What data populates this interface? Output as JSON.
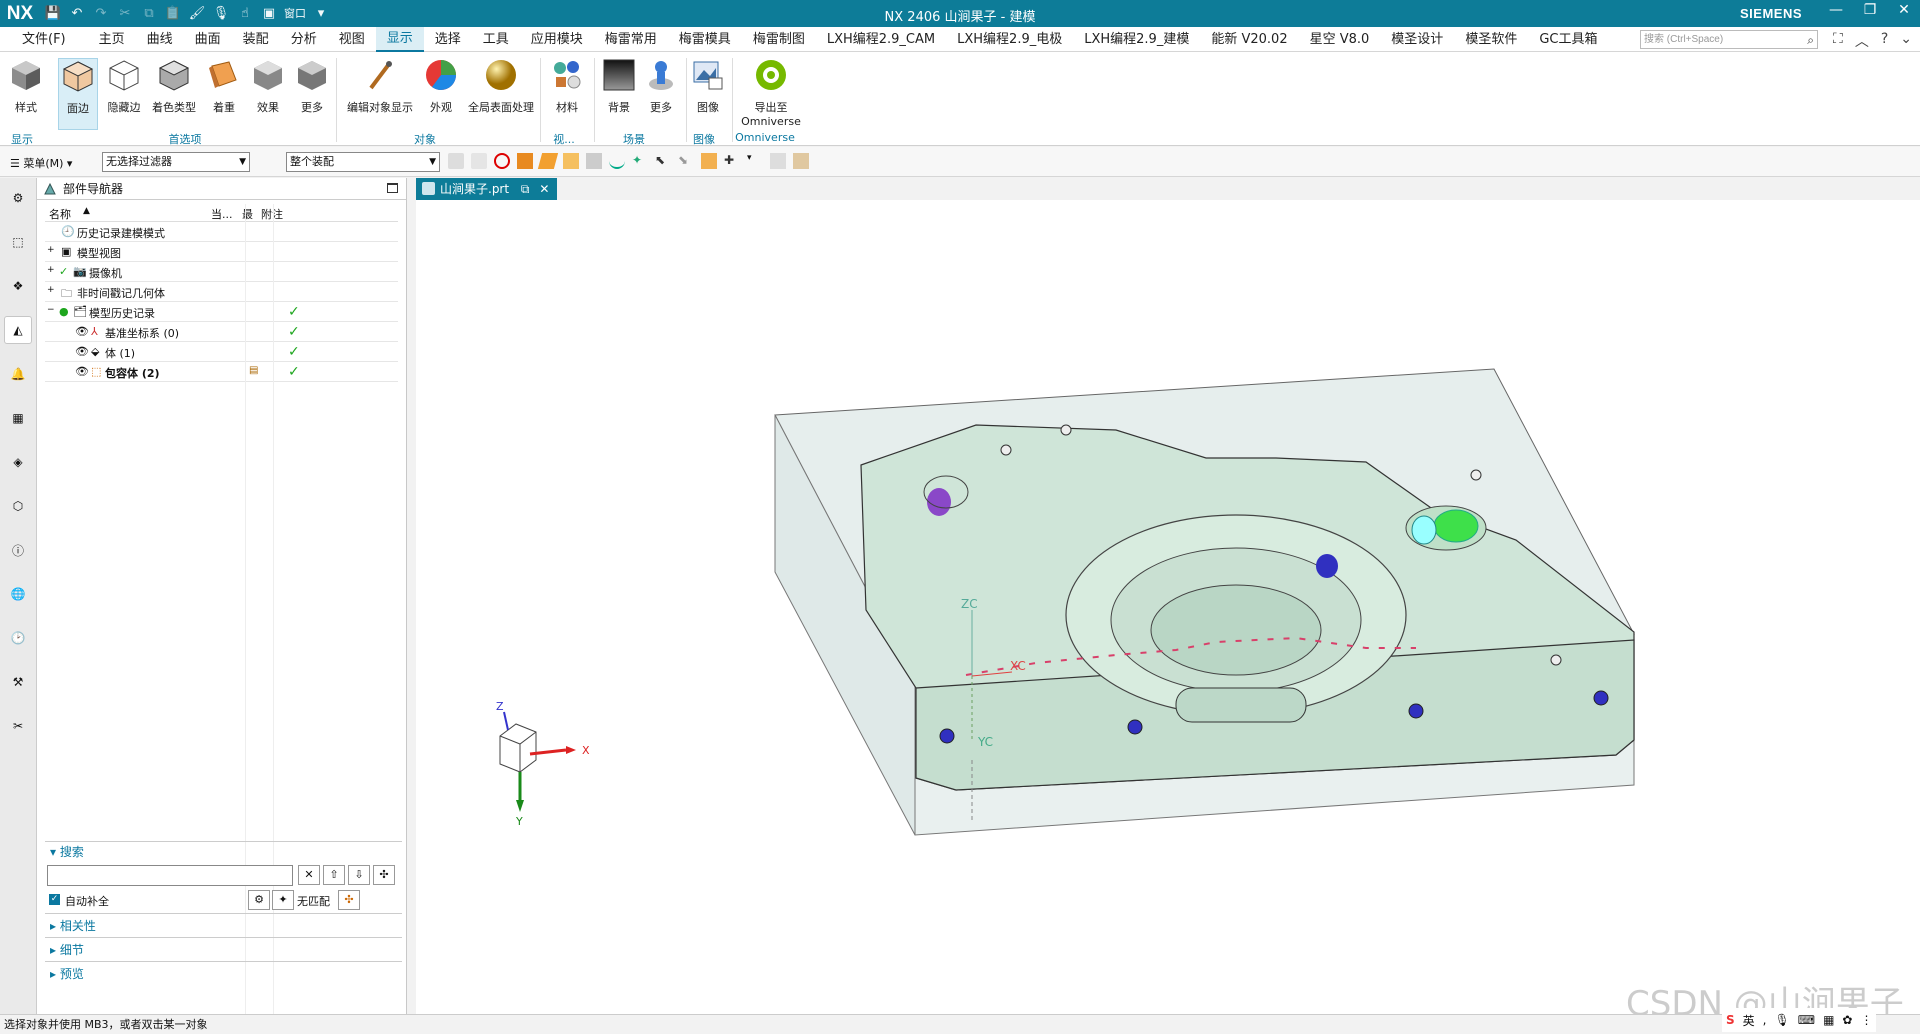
{
  "app": {
    "logo": "NX",
    "title": "NX 2406  山涧果子 - 建模",
    "brand": "SIEMENS",
    "window_menu": "窗口"
  },
  "menu": {
    "items": [
      "文件(F)",
      "主页",
      "曲线",
      "曲面",
      "装配",
      "分析",
      "视图",
      "显示",
      "选择",
      "工具",
      "应用模块",
      "梅雷常用",
      "梅雷模具",
      "梅雷制图",
      "LXH编程2.9_CAM",
      "LXH编程2.9_电极",
      "LXH编程2.9_建模",
      "能新 V20.02",
      "星空 V8.0",
      "模圣设计",
      "模圣软件",
      "GC工具箱"
    ],
    "active_index": 7,
    "search_placeholder": "搜索 (Ctrl+Space)"
  },
  "ribbon": {
    "buttons": [
      "样式",
      "面边",
      "隐藏边",
      "着色类型",
      "着重",
      "效果",
      "更多",
      "编辑对象显示",
      "外观",
      "全局表面处理",
      "材料",
      "背景",
      "更多",
      "图像",
      "导出至",
      "Omniverse"
    ],
    "groups": [
      "显示",
      "首选项",
      "对象",
      "视...",
      "场景",
      "图像",
      "Omniverse"
    ]
  },
  "toolbar2": {
    "menu": "菜单(M)",
    "filter": "无选择过滤器",
    "scope": "整个装配"
  },
  "navigator": {
    "title": "部件导航器",
    "columns": [
      "名称",
      "当...",
      "最",
      "附注"
    ],
    "rows": [
      {
        "label": "历史记录建模模式",
        "check": ""
      },
      {
        "label": "模型视图",
        "check": ""
      },
      {
        "label": "摄像机",
        "check": ""
      },
      {
        "label": "非时间戳记几何体",
        "check": ""
      },
      {
        "label": "模型历史记录",
        "check": "✓"
      },
      {
        "label": "基准坐标系 (0)",
        "check": "✓"
      },
      {
        "label": "体 (1)",
        "check": "✓"
      },
      {
        "label": "包容体 (2)",
        "check": "✓"
      }
    ]
  },
  "search": {
    "title": "搜索",
    "auto_complete": "自动补全",
    "no_match": "无匹配",
    "sections": [
      "相关性",
      "细节",
      "预览"
    ]
  },
  "doc_tab": {
    "label": "山涧果子.prt"
  },
  "viewport": {
    "axis_labels": {
      "zc": "ZC",
      "xc": "XC",
      "yc": "YC",
      "x": "X",
      "y": "Y",
      "z": "Z"
    }
  },
  "status": {
    "text": "选择对象并使用 MB3，或者双击某一对象"
  },
  "watermark": "CSDN @山涧果子",
  "tray": {
    "ime": "英"
  },
  "colors": {
    "title_bg": "#0d7c98",
    "accent": "#0b78a0",
    "part": "#cfe5d8",
    "box": "#e7efee"
  }
}
